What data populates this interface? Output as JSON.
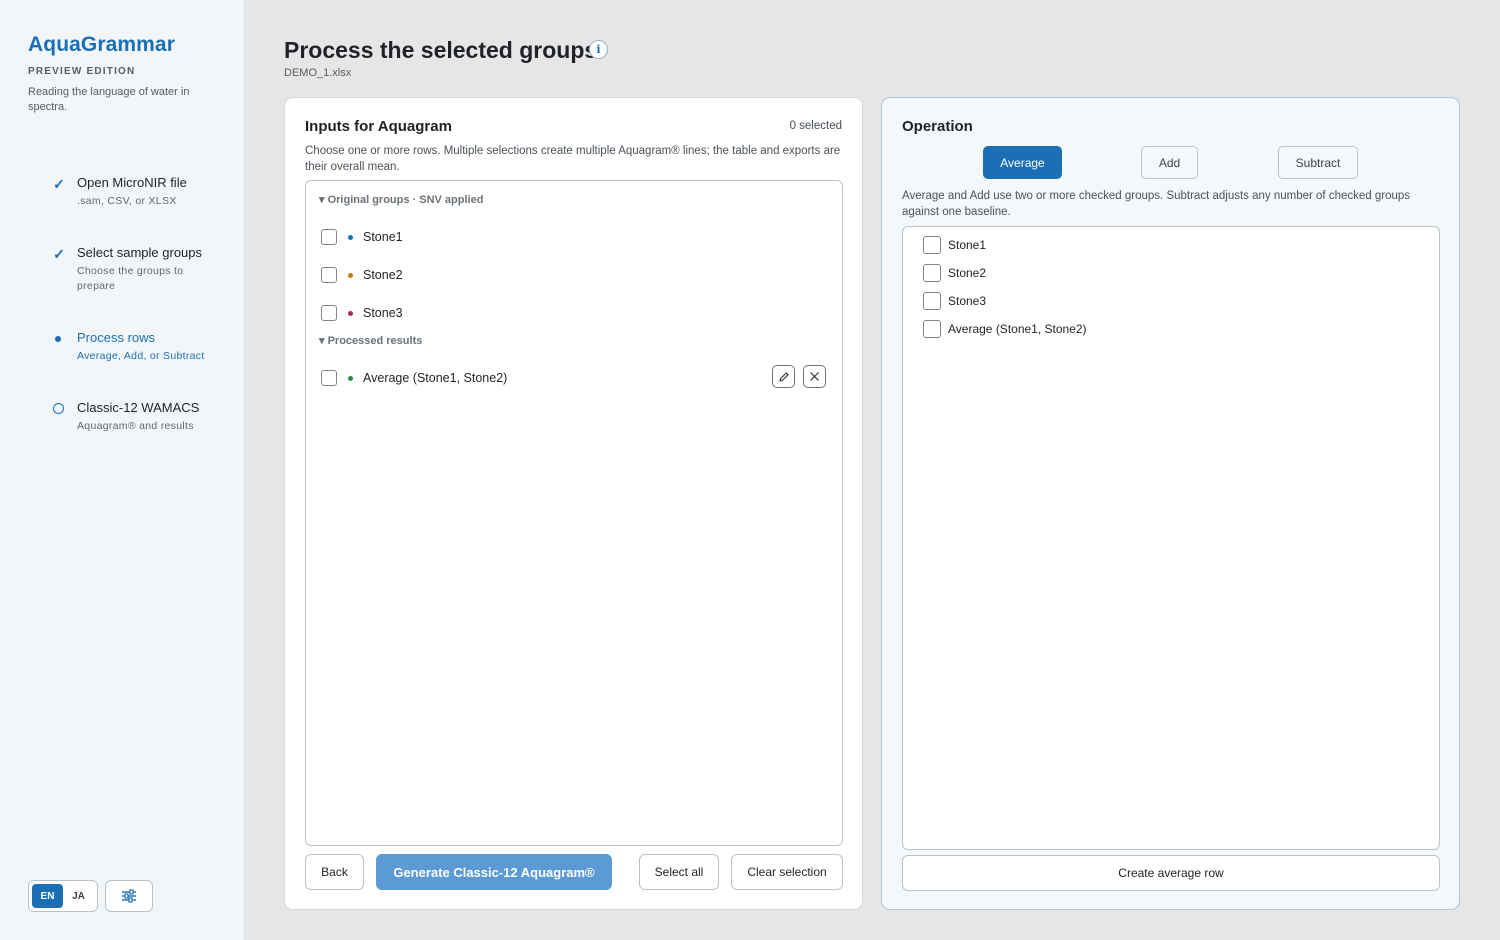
{
  "sidebar": {
    "brand": "AquaGrammar",
    "edition": "PREVIEW EDITION",
    "tagline": "Reading the language of water in spectra.",
    "steps": [
      {
        "title": "Open MicroNIR file",
        "subtitle": ".sam, CSV, or XLSX",
        "state": "done"
      },
      {
        "title": "Select sample groups",
        "subtitle": "Choose the groups to prepare",
        "state": "done"
      },
      {
        "title": "Process rows",
        "subtitle": "Average, Add, or Subtract",
        "state": "active"
      },
      {
        "title": "Classic-12 WAMACS",
        "subtitle": "Aquagram® and results",
        "state": "pending"
      }
    ],
    "languages": [
      "EN",
      "JA"
    ],
    "active_language": "EN",
    "settings_icon": "sliders-icon"
  },
  "header": {
    "title": "Process the selected groups",
    "info_icon": "info-icon",
    "file_name": "DEMO_1.xlsx"
  },
  "inputs_panel": {
    "heading": "Inputs for Aquagram",
    "selected_count": "0 selected",
    "description": "Choose one or more rows. Multiple selections create multiple Aquagram® lines; the table and exports are their overall mean.",
    "original_group_heading": "Original groups · SNV applied",
    "original_groups": [
      {
        "label": "Stone1",
        "color": "#1a6fb5",
        "checked": false
      },
      {
        "label": "Stone2",
        "color": "#c27b0e",
        "checked": false
      },
      {
        "label": "Stone3",
        "color": "#b0245a",
        "checked": false
      }
    ],
    "processed_heading": "Processed results",
    "processed_results": [
      {
        "label": "Average (Stone1, Stone2)",
        "color": "#2e8b3e",
        "checked": false,
        "edit_icon": "pencil-icon",
        "remove_icon": "close-icon"
      }
    ],
    "buttons": {
      "back": "Back",
      "generate": "Generate Classic-12 Aquagram®",
      "select_all": "Select all",
      "clear": "Clear selection"
    }
  },
  "operation_panel": {
    "heading": "Operation",
    "operations": [
      "Average",
      "Add",
      "Subtract"
    ],
    "active_operation": "Average",
    "description": "Average and Add use two or more checked groups. Subtract adjusts any number of checked groups against one baseline.",
    "items": [
      {
        "label": "Stone1",
        "checked": false
      },
      {
        "label": "Stone2",
        "checked": false
      },
      {
        "label": "Stone3",
        "checked": false
      },
      {
        "label": "Average (Stone1, Stone2)",
        "checked": false
      }
    ],
    "create_button": "Create average row"
  }
}
